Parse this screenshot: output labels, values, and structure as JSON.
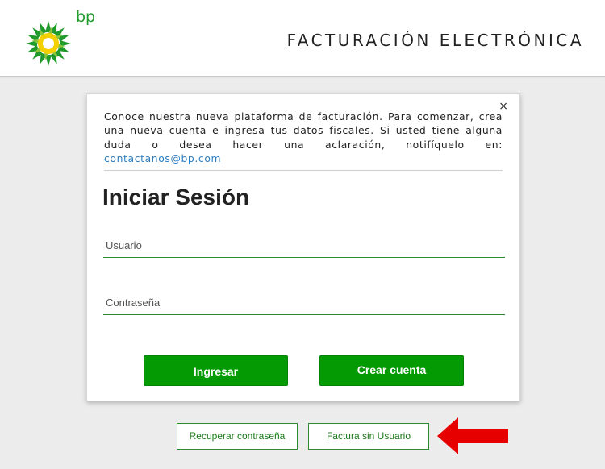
{
  "brand": {
    "logo_text": "bp",
    "logo_green": "#1f9a2b",
    "logo_yellow": "#f4d000"
  },
  "header": {
    "title": "FACTURACIÓN ELECTRÓNICA"
  },
  "notice": {
    "text": "Conoce nuestra nueva plataforma de facturación. Para comenzar, crea una nueva cuenta e ingresa tus datos fiscales. Si usted tiene alguna duda o desea hacer una aclaración, notifíquelo en: ",
    "email": "contactanos@bp.com",
    "close_label": "×"
  },
  "login": {
    "title": "Iniciar Sesión",
    "user_placeholder": "Usuario",
    "user_value": "",
    "password_placeholder": "Contraseña",
    "password_value": "",
    "login_button": "Ingresar",
    "create_button": "Crear cuenta"
  },
  "footer": {
    "recover_button": "Recuperar contraseña",
    "invoice_button": "Factura sin Usuario"
  },
  "colors": {
    "accent_green": "#049a04",
    "link_blue": "#2e7dbf",
    "arrow_red": "#e60000"
  }
}
